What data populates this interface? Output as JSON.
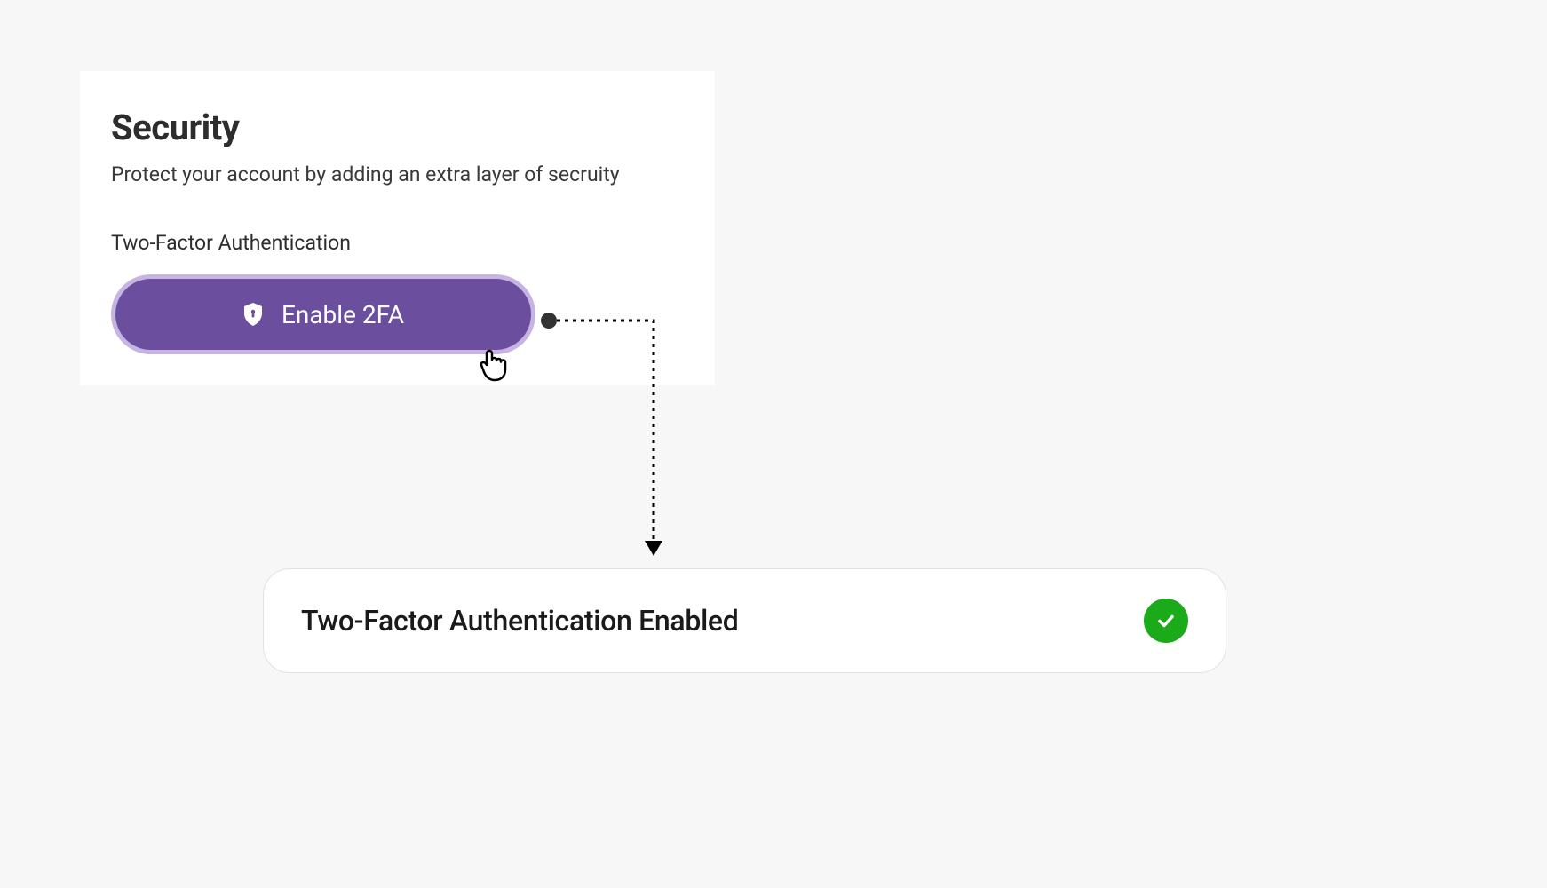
{
  "security": {
    "title": "Security",
    "subtitle": "Protect your account by adding an extra layer of secruity",
    "section_label": "Two-Factor Authentication",
    "button_label": "Enable 2FA"
  },
  "toast": {
    "message": "Two-Factor Authentication Enabled"
  },
  "colors": {
    "button_bg": "#6b4f9e",
    "button_border": "#c6b4e3",
    "success": "#1aaa1a"
  }
}
